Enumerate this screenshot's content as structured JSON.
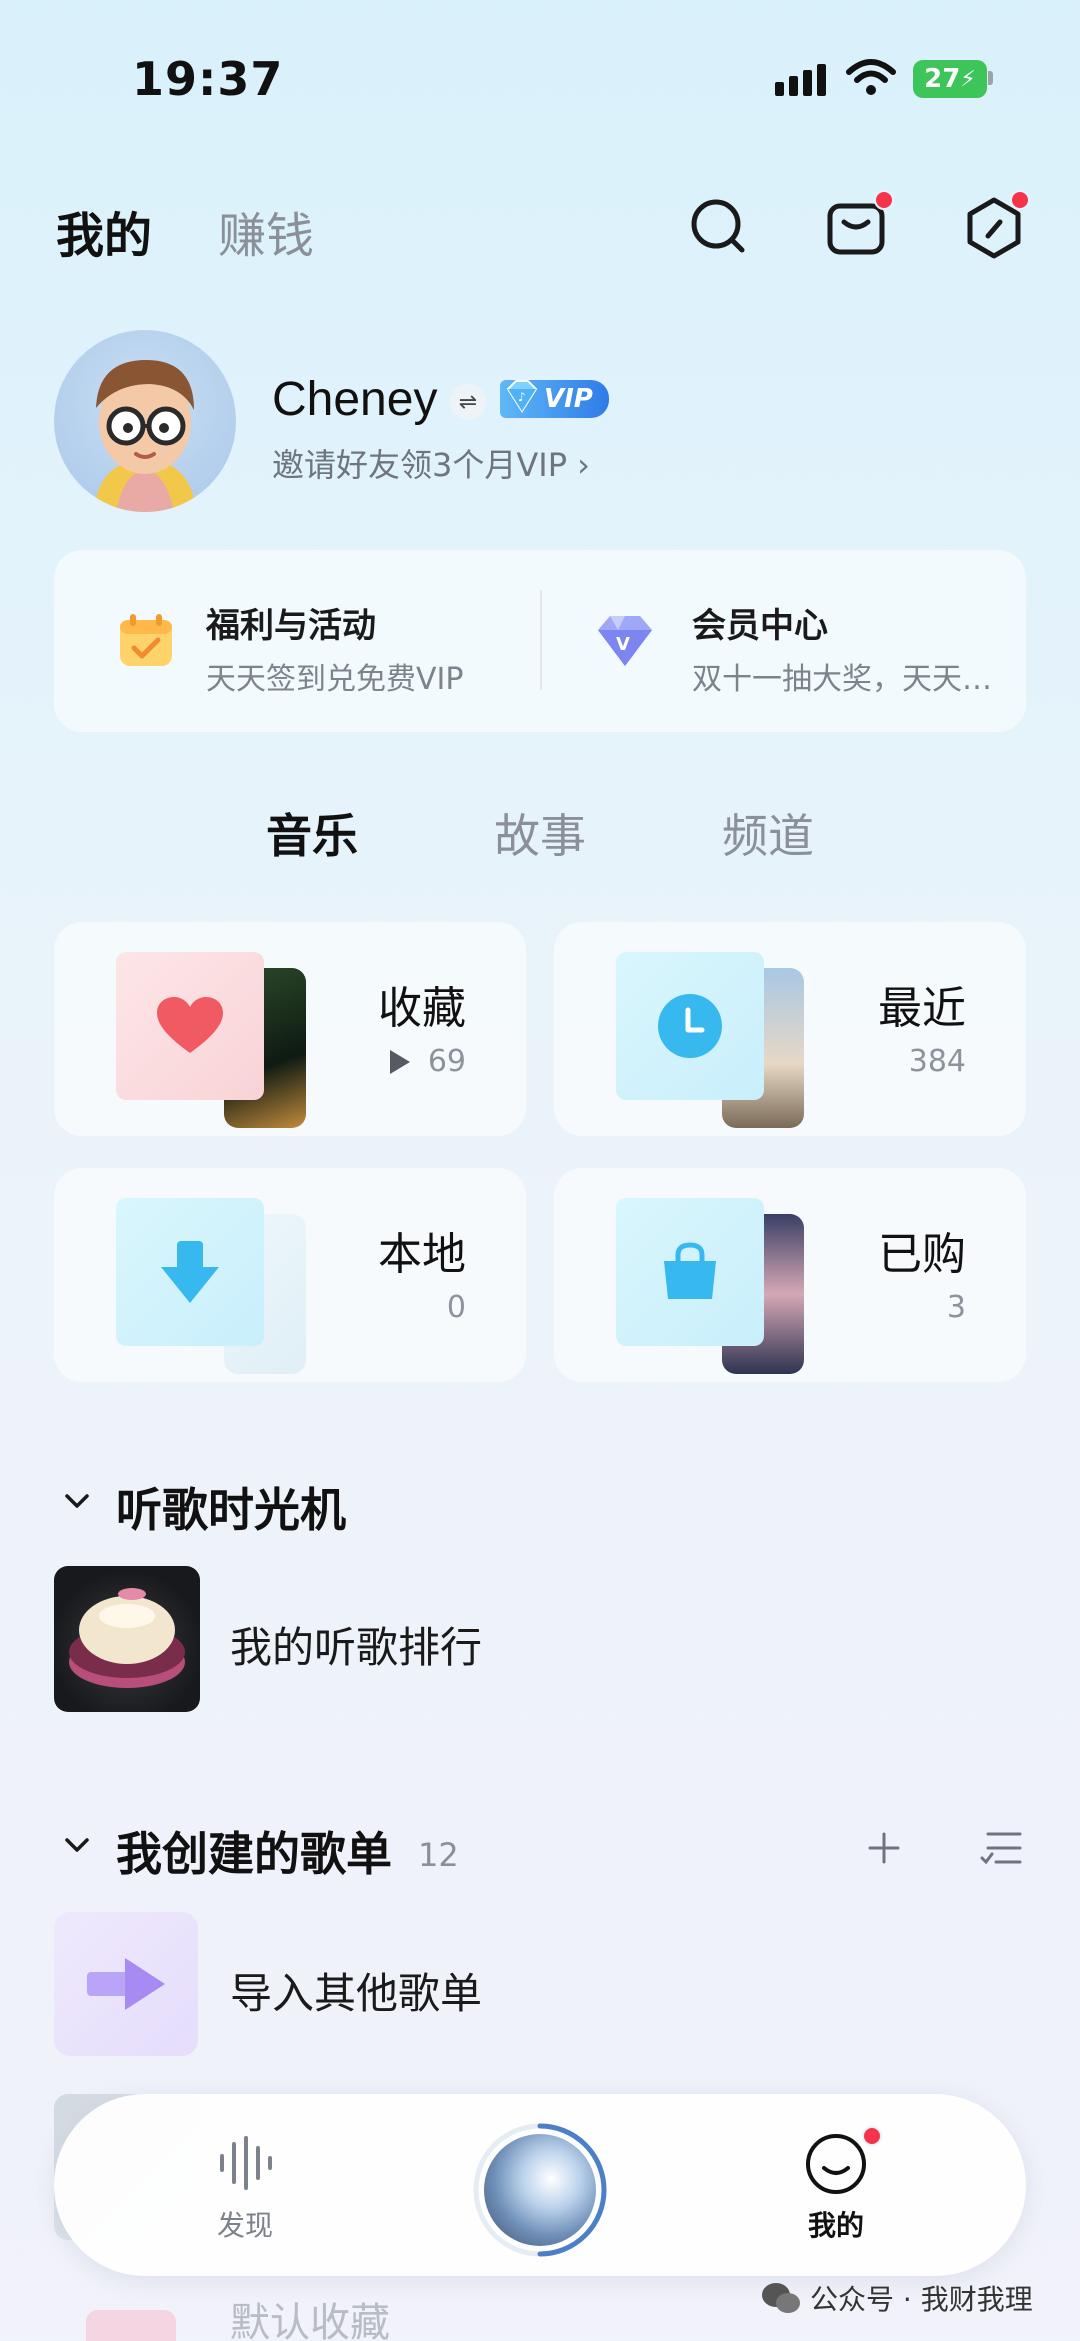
{
  "status_bar": {
    "time": "19:37",
    "battery": "27"
  },
  "header": {
    "tab_mine": "我的",
    "tab_earn": "赚钱"
  },
  "profile": {
    "name": "Cheney",
    "vip": "VIP",
    "invite": "邀请好友领3个月VIP ›"
  },
  "benefits": [
    {
      "title": "福利与活动",
      "subtitle": "天天签到兑免费VIP"
    },
    {
      "title": "会员中心",
      "subtitle": "双十一抽大奖，天天…"
    }
  ],
  "section_tabs": [
    "音乐",
    "故事",
    "频道"
  ],
  "grid": [
    {
      "title": "收藏",
      "count": "69"
    },
    {
      "title": "最近",
      "count": "384"
    },
    {
      "title": "本地",
      "count": "0"
    },
    {
      "title": "已购",
      "count": "3"
    }
  ],
  "time_machine": {
    "heading": "听歌时光机",
    "item": "我的听歌排行"
  },
  "playlists": {
    "heading": "我创建的歌单",
    "count": "12",
    "import_label": "导入其他歌单",
    "faded_label": "默认收藏"
  },
  "bottom_nav": {
    "discover": "发现",
    "mine": "我的"
  },
  "watermark": "公众号 · 我财我理",
  "colors": {
    "accent_red": "#f5334b",
    "vip_blue": "#2f7be8",
    "heart": "#f25a63",
    "clock": "#37b8ee"
  }
}
